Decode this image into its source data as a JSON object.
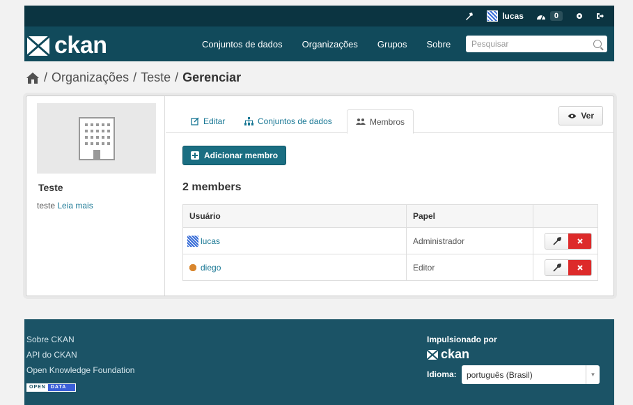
{
  "account": {
    "username": "lucas",
    "activity_count": "0"
  },
  "masthead": {
    "logo_text": "ckan",
    "nav": [
      "Conjuntos de dados",
      "Organizações",
      "Grupos",
      "Sobre"
    ],
    "search_placeholder": "Pesquisar"
  },
  "breadcrumb": {
    "items": [
      "Organizações",
      "Teste"
    ],
    "active": "Gerenciar",
    "separator": "/"
  },
  "sidebar": {
    "org_title": "Teste",
    "org_description": "teste",
    "read_more": "Leia mais"
  },
  "tabs": [
    {
      "label": "Editar"
    },
    {
      "label": "Conjuntos de dados"
    },
    {
      "label": "Membros"
    }
  ],
  "view_button": "Ver",
  "add_member_button": "Adicionar membro",
  "members_count": "2 members",
  "table": {
    "headers": [
      "Usuário",
      "Papel",
      ""
    ],
    "rows": [
      {
        "user": "lucas",
        "role": "Administrador"
      },
      {
        "user": "diego",
        "role": "Editor"
      }
    ]
  },
  "footer": {
    "links": [
      "Sobre CKAN",
      "API do CKAN",
      "Open Knowledge Foundation"
    ],
    "open_data_badge": [
      "OPEN",
      "DATA"
    ],
    "powered_by": "Impulsionado por",
    "powered_logo": "ckan",
    "language_label": "Idioma:",
    "language_value": "português (Brasil)"
  },
  "colors": {
    "masthead": "#114a5b",
    "accountbar": "#0b3441",
    "footer": "#1b5366",
    "link": "#187794",
    "primary_button": "#1a6e82",
    "delete_button": "#dd2a2a"
  }
}
